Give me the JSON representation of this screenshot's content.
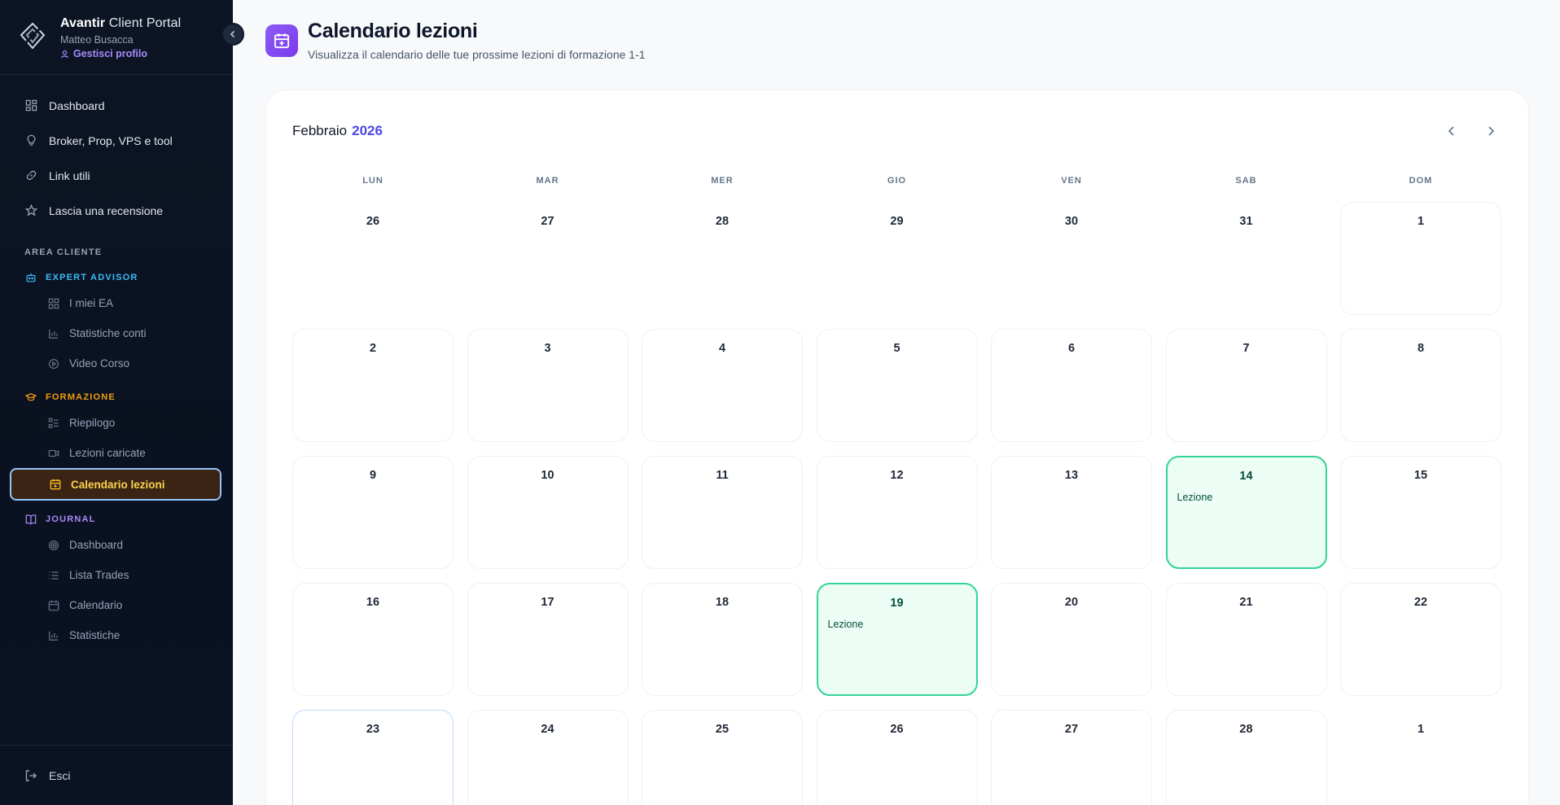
{
  "brand": {
    "name_bold": "Avantir",
    "name_light": "Client Portal",
    "user": "Matteo Busacca",
    "profile_link": "Gestisci profilo"
  },
  "nav": [
    {
      "label": "Dashboard",
      "icon": "grid-icon"
    },
    {
      "label": "Broker, Prop, VPS e tool",
      "icon": "lightbulb-icon"
    },
    {
      "label": "Link utili",
      "icon": "link-icon"
    },
    {
      "label": "Lascia una recensione",
      "icon": "star-icon"
    }
  ],
  "area_label": "AREA CLIENTE",
  "groups": {
    "expert_advisor": {
      "label": "EXPERT ADVISOR",
      "color": "#38bdf8",
      "items": [
        "I miei EA",
        "Statistiche conti",
        "Video Corso"
      ]
    },
    "formazione": {
      "label": "FORMAZIONE",
      "color": "#f59e0b",
      "items": [
        "Riepilogo",
        "Lezioni caricate",
        "Calendario lezioni"
      ]
    },
    "journal": {
      "label": "JOURNAL",
      "color": "#a78bfa",
      "items": [
        "Dashboard",
        "Lista Trades",
        "Calendario",
        "Statistiche"
      ]
    }
  },
  "logout_label": "Esci",
  "page": {
    "title": "Calendario lezioni",
    "subtitle": "Visualizza il calendario delle tue prossime lezioni di formazione 1-1"
  },
  "calendar": {
    "month": "Febbraio",
    "year": "2026",
    "weekdays": [
      "LUN",
      "MAR",
      "MER",
      "GIO",
      "VEN",
      "SAB",
      "DOM"
    ],
    "event_label": "Lezione",
    "days": [
      {
        "n": "26",
        "t": "outside"
      },
      {
        "n": "27",
        "t": "outside"
      },
      {
        "n": "28",
        "t": "outside"
      },
      {
        "n": "29",
        "t": "outside"
      },
      {
        "n": "30",
        "t": "outside"
      },
      {
        "n": "31",
        "t": "outside"
      },
      {
        "n": "1",
        "t": "normal"
      },
      {
        "n": "2",
        "t": "normal"
      },
      {
        "n": "3",
        "t": "normal"
      },
      {
        "n": "4",
        "t": "normal"
      },
      {
        "n": "5",
        "t": "normal"
      },
      {
        "n": "6",
        "t": "normal"
      },
      {
        "n": "7",
        "t": "normal"
      },
      {
        "n": "8",
        "t": "normal"
      },
      {
        "n": "9",
        "t": "normal"
      },
      {
        "n": "10",
        "t": "normal"
      },
      {
        "n": "11",
        "t": "normal"
      },
      {
        "n": "12",
        "t": "normal"
      },
      {
        "n": "13",
        "t": "normal"
      },
      {
        "n": "14",
        "t": "event"
      },
      {
        "n": "15",
        "t": "normal"
      },
      {
        "n": "16",
        "t": "normal"
      },
      {
        "n": "17",
        "t": "normal"
      },
      {
        "n": "18",
        "t": "normal"
      },
      {
        "n": "19",
        "t": "event"
      },
      {
        "n": "20",
        "t": "normal"
      },
      {
        "n": "21",
        "t": "normal"
      },
      {
        "n": "22",
        "t": "normal"
      },
      {
        "n": "23",
        "t": "today"
      },
      {
        "n": "24",
        "t": "normal"
      },
      {
        "n": "25",
        "t": "normal"
      },
      {
        "n": "26",
        "t": "normal"
      },
      {
        "n": "27",
        "t": "normal"
      },
      {
        "n": "28",
        "t": "normal"
      },
      {
        "n": "1",
        "t": "outside"
      }
    ]
  }
}
